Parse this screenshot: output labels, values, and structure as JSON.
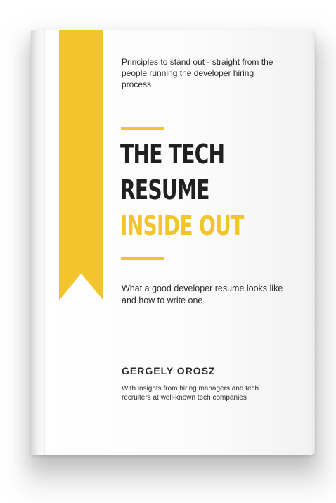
{
  "book": {
    "tagline": "Principles to stand out - straight from the people running the developer hiring process",
    "title_line_1": "THE TECH",
    "title_line_2": "RESUME",
    "title_line_3": "INSIDE OUT",
    "description": "What a good developer resume looks like and how to write one",
    "author": "GERGELY OROSZ",
    "insights": "With insights from hiring managers and tech recruiters at well-known tech companies"
  },
  "colors": {
    "accent_yellow": "#f2c52c",
    "title_dark": "#202020",
    "cover_white": "#ffffff"
  }
}
